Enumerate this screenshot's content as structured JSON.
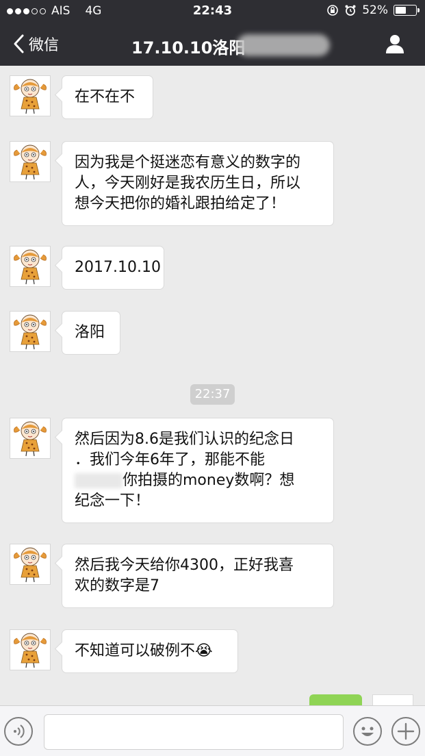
{
  "status": {
    "carrier": "AIS",
    "network": "4G",
    "time": "22:43",
    "battery": "52%",
    "battery_level": 0.52
  },
  "nav": {
    "back_label": "微信",
    "title": "17.10.10洛阳"
  },
  "messages": [
    {
      "lines": [
        "在不在不"
      ]
    },
    {
      "lines": [
        "因为我是个挺迷恋有意义的数字的",
        "人，今天刚好是我农历生日，所以",
        "想今天把你的婚礼跟拍给定了！"
      ]
    },
    {
      "lines": [
        "2017.10.10"
      ]
    },
    {
      "lines": [
        "洛阳"
      ]
    },
    {
      "lines": [
        "然后因为8.6是我们认识的纪念日",
        "．我们今年6年了，那能不能",
        "你拍摄的money数啊？想",
        "纪念一下！"
      ]
    },
    {
      "lines": [
        "然后我今天给你4300，正好我喜",
        "欢的数字是7"
      ]
    },
    {
      "lines": [
        "不知道可以破例不😭"
      ]
    }
  ],
  "timestamp": "22:37",
  "input": {
    "value": "",
    "placeholder": ""
  },
  "icons": {
    "back": "chevron-left-icon",
    "profile": "person-icon",
    "voice": "voice-icon",
    "emoji": "emoji-icon",
    "plus": "plus-icon",
    "alarm": "alarm-icon",
    "lock": "rotation-lock-icon"
  },
  "colors": {
    "nav_bg": "#2e2e33",
    "chat_bg": "#ebebeb",
    "bubble_bg": "#ffffff",
    "sent_bubble": "#8fd455",
    "timestamp_bg": "#cfcfcf"
  }
}
